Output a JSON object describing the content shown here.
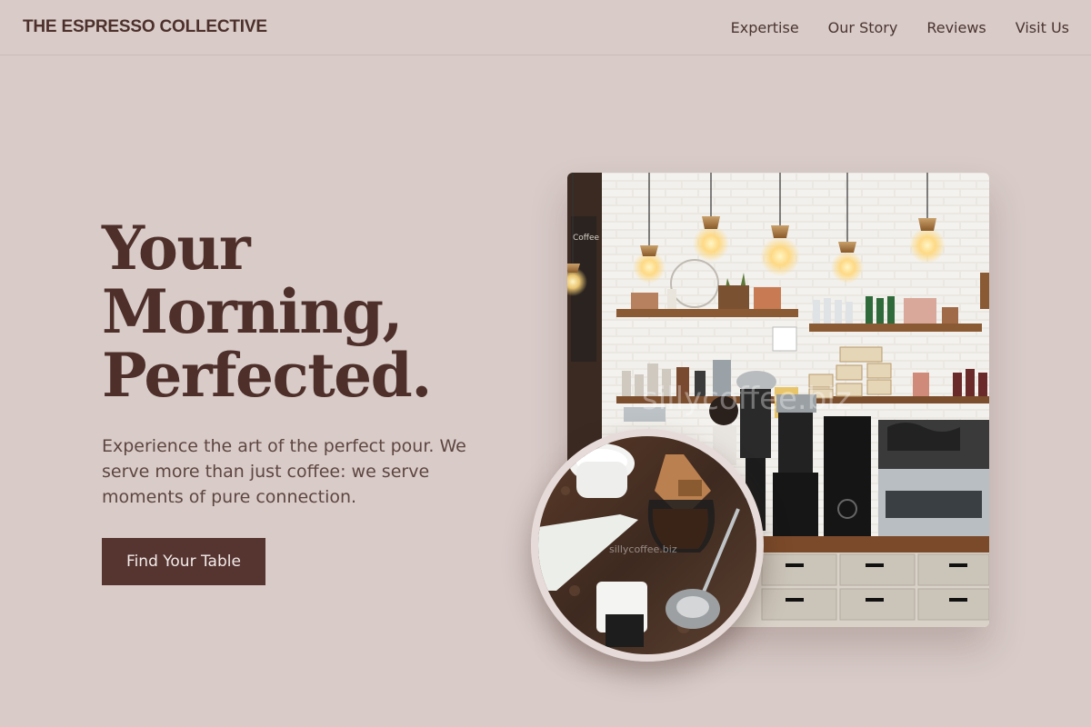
{
  "header": {
    "brand": "THE ESPRESSO COLLECTIVE",
    "nav": [
      {
        "label": "Expertise"
      },
      {
        "label": "Our Story"
      },
      {
        "label": "Reviews"
      },
      {
        "label": "Visit Us"
      }
    ]
  },
  "hero": {
    "title_lines": [
      "Your",
      "Morning,",
      "Perfected."
    ],
    "subtitle": "Experience the art of the perfect pour. We serve more than just coffee: we serve moments of pure connection.",
    "cta_label": "Find Your Table"
  },
  "images": {
    "main": {
      "subject": "cafe counter with pendant bulbs, shelves and espresso machine",
      "watermark": "sillycoffee.biz"
    },
    "circle": {
      "subject": "chemex pour-over, white cup and card reader on table",
      "watermark": "sillycoffee.biz"
    }
  },
  "colors": {
    "background": "#d8cbc8",
    "accent": "#563531",
    "text": "#4e2f2a"
  }
}
